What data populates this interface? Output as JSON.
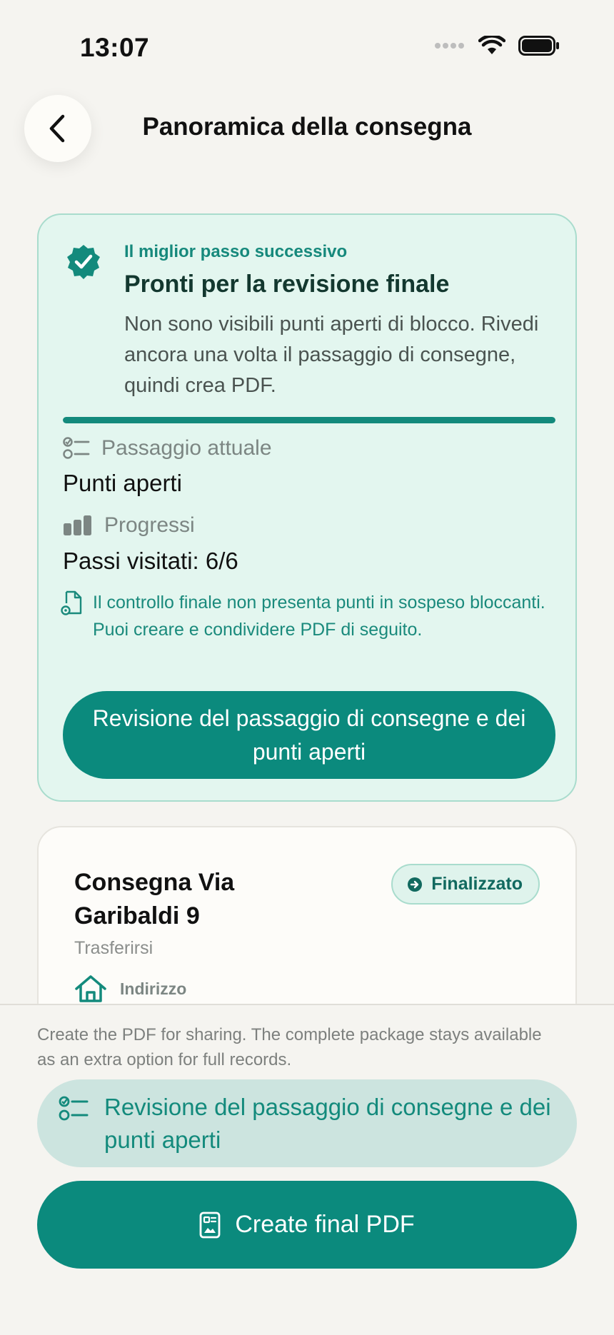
{
  "status_bar": {
    "time": "13:07"
  },
  "header": {
    "title": "Panoramica della consegna"
  },
  "next_step": {
    "eyebrow": "Il miglior passo successivo",
    "heading": "Pronti per la revisione finale",
    "description": "Non sono visibili punti aperti di blocco. Rivedi ancora una volta il passaggio di consegne, quindi crea PDF.",
    "progress_fraction": 1.0,
    "current_step_label": "Passaggio attuale",
    "current_step_value": "Punti aperti",
    "progress_label": "Progressi",
    "progress_value": "Passi visitati: 6/6",
    "info_text": "Il controllo finale non presenta punti in sospeso bloccanti. Puoi creare e condividere PDF di seguito.",
    "review_button": "Revisione del passaggio di consegne e dei punti aperti"
  },
  "delivery": {
    "title": "Consegna Via Garibaldi 9",
    "subtitle": "Trasferirsi",
    "status": "Finalizzato",
    "address_label": "Indirizzo"
  },
  "bottom": {
    "note": "Create the PDF for sharing. The complete package stays available as an extra option for full records.",
    "secondary_button": "Revisione del passaggio di consegne e dei punti aperti",
    "create_button": "Create final PDF"
  },
  "colors": {
    "accent": "#0b8a7d",
    "card_bg": "#e3f6ef",
    "background": "#f5f4f0"
  }
}
